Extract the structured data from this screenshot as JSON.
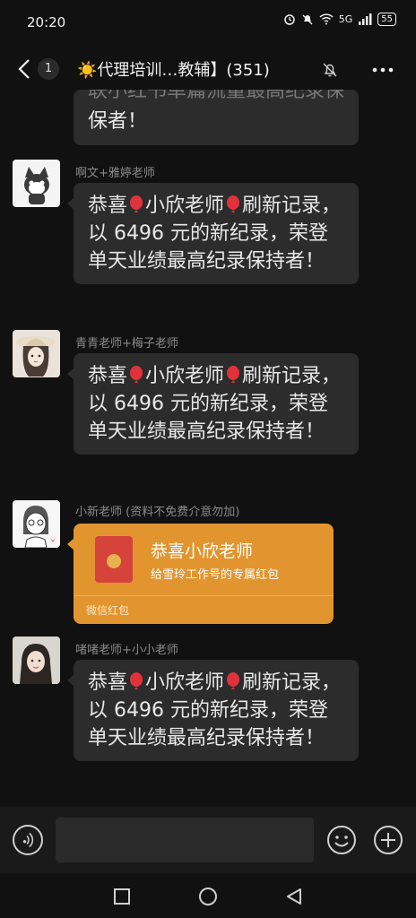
{
  "status_bar": {
    "time": "20:20",
    "network": "5G",
    "battery": "55"
  },
  "header": {
    "back_count": "1",
    "title": "☀️代理培训…教辅】(351)"
  },
  "messages": [
    {
      "type": "text_partial",
      "text": "联小红书单篇流量最高纪录保者！",
      "text_tail": "保者！"
    },
    {
      "type": "text",
      "sender": "啊文+雅婷老师",
      "avatar": "cat-avatar",
      "line1_a": "恭喜",
      "line1_b": "小欣老师",
      "line1_c": "刷新记",
      "rest": "录，以 6496 元的新纪录，荣登单天业绩最高纪录保持者！"
    },
    {
      "type": "text",
      "sender": "青青老师+梅子老师",
      "avatar": "girl-hat-avatar",
      "line1_a": "恭喜",
      "line1_b": "小欣老师",
      "line1_c": "刷新记",
      "rest": "录，以 6496 元的新纪录，荣登单天业绩最高纪录保持者！"
    },
    {
      "type": "red_packet",
      "sender": "小新老师 (资料不免费介意勿加)",
      "avatar": "cartoon-girl-avatar",
      "title": "恭喜小欣老师",
      "subtitle": "给雪玲工作号的专属红包",
      "footer": "微信红包"
    },
    {
      "type": "text",
      "sender": "啫啫老师+小小老师",
      "avatar": "photo-girl-avatar",
      "line1_a": "恭喜",
      "line1_b": "小欣老师",
      "line1_c": "刷新记",
      "rest": "录，以 6496 元的新纪录，荣登单天业绩最高纪录保持者！"
    }
  ],
  "input": {
    "value": "",
    "placeholder": ""
  },
  "colors": {
    "background": "#111111",
    "bubble": "#2c2c2c",
    "red_packet": "#e2952f",
    "sender_text": "#8a8a8a"
  }
}
